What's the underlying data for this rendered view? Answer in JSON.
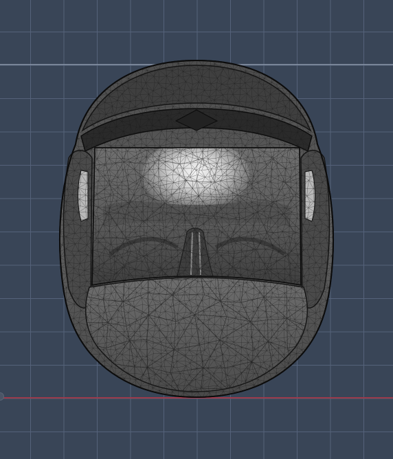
{
  "viewport": {
    "background_color": "#394557",
    "grid_minor_color": "#55627a",
    "grid_major_color": "#8a95a8",
    "x_axis_color": "#9c3b4c",
    "render_mode": "wireframe-over-shaded",
    "object": "helmet-mesh"
  },
  "model": {
    "shell_color": "#5a5a5a",
    "shell_dark_color": "#262626",
    "visor_color": "#6c6c6c",
    "interior_highlight_color": "#e9e9e9",
    "wire_color": "#1c1c1c"
  }
}
